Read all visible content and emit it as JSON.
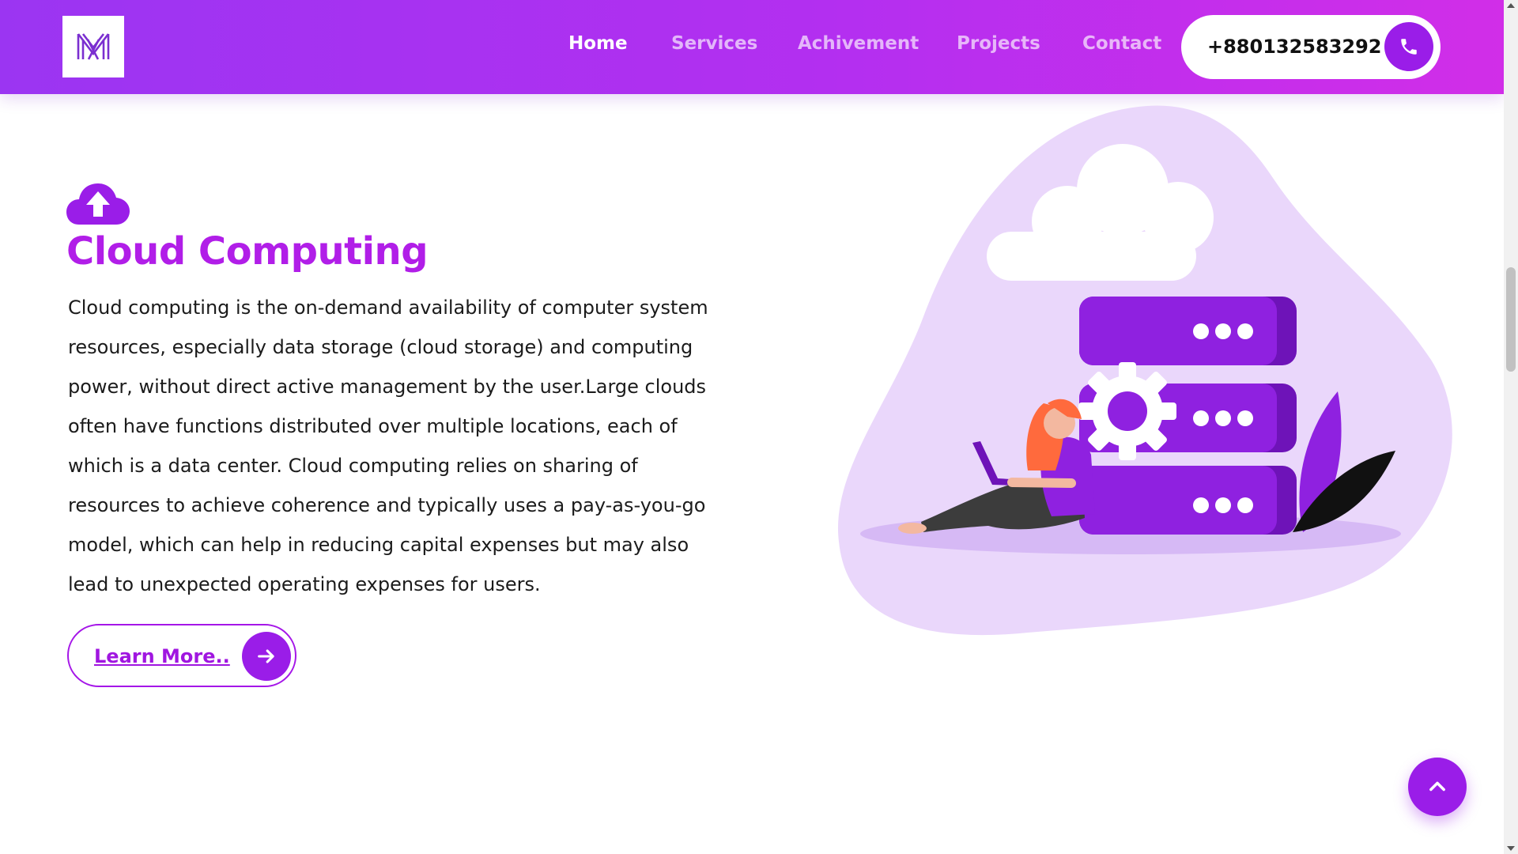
{
  "header": {
    "nav": [
      {
        "label": "Home",
        "active": true
      },
      {
        "label": "Services",
        "active": false
      },
      {
        "label": "Achivement",
        "active": false
      },
      {
        "label": "Projects",
        "active": false
      },
      {
        "label": "Contact",
        "active": false
      }
    ],
    "phone": "+880132583292",
    "icons": {
      "logo": "m-logo",
      "phone": "phone-icon"
    }
  },
  "main": {
    "icon": "cloud-upload-icon",
    "title": "Cloud Computing",
    "description": "Cloud computing is the on-demand availability of computer system resources, especially data storage (cloud storage) and computing power, without direct active management by the user.Large clouds often have functions distributed over multiple locations, each of which is a data center. Cloud computing relies on sharing of resources to achieve coherence and typically uses a pay-as-you-go model, which can help in reducing capital expenses but may also lead to unexpected operating expenses for users.",
    "button_label": "Learn More..",
    "button_icon": "arrow-right-icon"
  },
  "scroll_top_icon": "chevron-up-icon",
  "colors": {
    "header_gradient_start": "#9b35f2",
    "header_gradient_end": "#d12ee8",
    "accent": "#9a1de8",
    "title": "#b11ee8",
    "blob": "#ead7fb"
  }
}
